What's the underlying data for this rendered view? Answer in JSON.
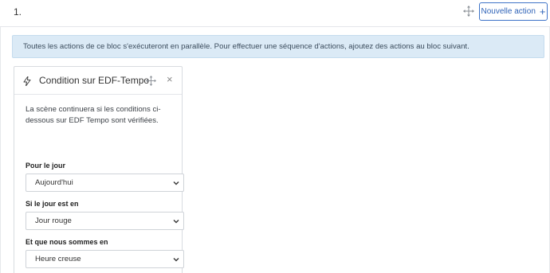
{
  "block": {
    "number": "1.",
    "new_action_label": "Nouvelle action",
    "new_action_icon": "plus-icon",
    "move_icon": "move-icon"
  },
  "info_banner": {
    "text": "Toutes les actions de ce bloc s'exécuteront en parallèle. Pour effectuer une séquence d'actions, ajoutez des actions au bloc suivant."
  },
  "action_card": {
    "title": "Condition sur EDF-Tempo",
    "icon": "bolt-icon",
    "description": "La scène continuera si les conditions ci-dessous sur EDF Tempo sont vérifiées.",
    "fields": [
      {
        "label": "Pour le jour",
        "value": "Aujourd'hui"
      },
      {
        "label": "Si le jour est en",
        "value": "Jour rouge"
      },
      {
        "label": "Et que nous sommes en",
        "value": "Heure creuse"
      }
    ]
  },
  "colors": {
    "primary": "#3e73c8",
    "banner_bg": "#dbeaf6",
    "border": "#d8dbe0"
  }
}
